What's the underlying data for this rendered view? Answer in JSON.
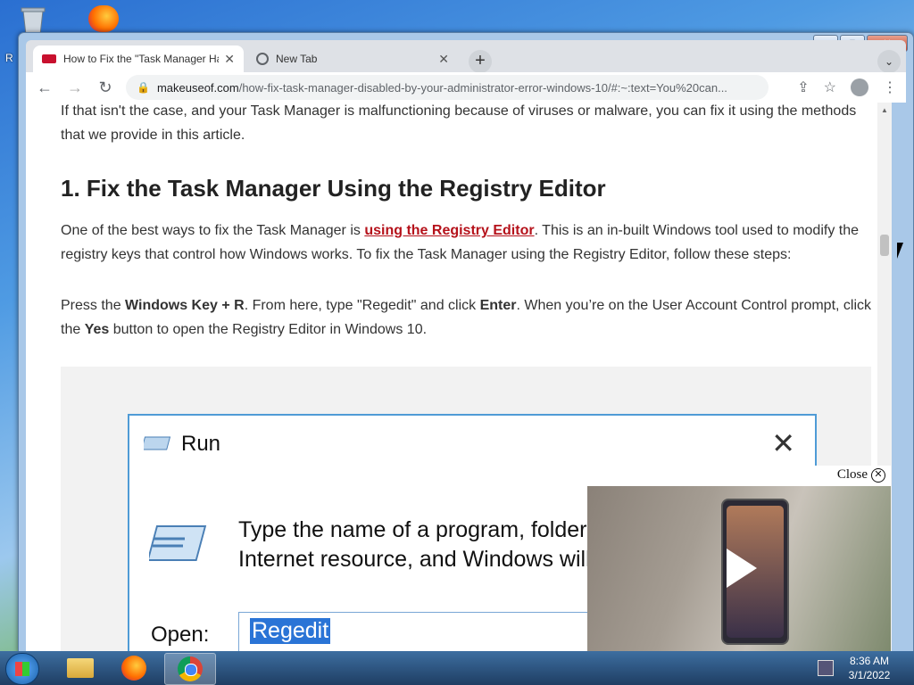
{
  "desktop": {
    "partial_label": "R"
  },
  "browser": {
    "tabs": [
      {
        "title": "How to Fix the \"Task Manager Ha",
        "favicon": "muo-favicon-icon",
        "active": true
      },
      {
        "title": "New Tab",
        "favicon": "chrome-favicon-icon",
        "active": false
      }
    ],
    "new_tab_label": "+",
    "url_host": "makeuseof.com",
    "url_path": "/how-fix-task-manager-disabled-by-your-administrator-error-windows-10/#:~:text=You%20can...",
    "window_controls": {
      "minimize": "▭",
      "maximize": "▢",
      "close": "✕"
    }
  },
  "article": {
    "intro": "If that isn't the case, and your Task Manager is malfunctioning because of viruses or malware, you can fix it using the methods that we provide in this article.",
    "heading": "1. Fix the Task Manager Using the Registry Editor",
    "p2_before": "One of the best ways to fix the Task Manager is ",
    "p2_link": "using the Registry Editor",
    "p2_after": ". This is an in-built Windows tool used to modify the registry keys that control how Windows works. To fix the Task Manager using the Registry Editor, follow these steps:",
    "p3_a": "Press the ",
    "p3_b": "Windows Key + R",
    "p3_c": ". From here, type \"Regedit\" and click ",
    "p3_d": "Enter",
    "p3_e": ". When you’re on the User Account Control prompt, click the ",
    "p3_f": "Yes",
    "p3_g": " button to open the Registry Editor in Windows 10."
  },
  "run_dialog": {
    "title": "Run",
    "close": "✕",
    "text_line1": "Type the name of a program, folder",
    "text_line2": "Internet resource, and Windows will",
    "open_label": "Open:",
    "input_value": "Regedit"
  },
  "video_popup": {
    "close_label": "Close",
    "close_icon": "⊗"
  },
  "taskbar": {
    "time": "8:36 AM",
    "date": "3/1/2022"
  }
}
